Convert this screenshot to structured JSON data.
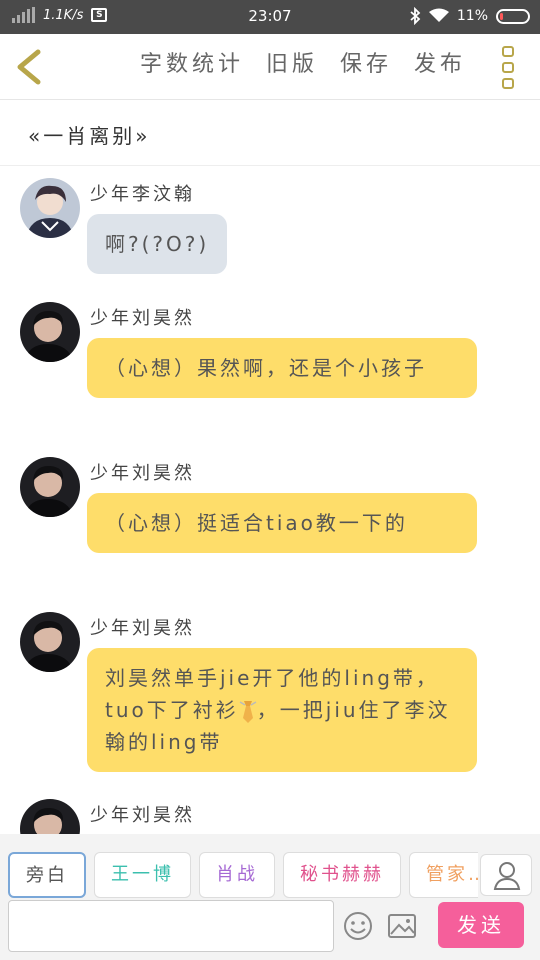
{
  "status_bar": {
    "speed": "1.1K/s",
    "screen_badge": "S",
    "time": "23:07",
    "battery_text": "11%",
    "battery_level": 0.11
  },
  "toolbar": {
    "actions": [
      "字数统计",
      "旧版",
      "保存",
      "发布"
    ],
    "accent": "#b8a64a"
  },
  "story": {
    "title": "«一肖离别»"
  },
  "messages": [
    {
      "name": "少年李汶翰",
      "text": "啊?(?O?)",
      "style": "gray",
      "avatar": "avatar-li-wenhan"
    },
    {
      "name": "少年刘昊然",
      "text": "（心想）果然啊，还是个小孩子",
      "style": "yellow",
      "avatar": "avatar-liu-haoran"
    },
    {
      "name": "少年刘昊然",
      "text": "（心想）挺适合tiao教一下的",
      "style": "yellow",
      "avatar": "avatar-liu-haoran"
    },
    {
      "name": "少年刘昊然",
      "text_before": "刘昊然单手jie开了他的ling带，tuo下了衬衫",
      "text_after": "，一把jiu住了李汶翰的ling带",
      "style": "yellow",
      "avatar": "avatar-liu-haoran"
    },
    {
      "name": "少年刘昊然",
      "style": "yellow",
      "avatar": "avatar-liu-haoran"
    }
  ],
  "roles": [
    {
      "label": "旁白",
      "color": "#555555",
      "active": true
    },
    {
      "label": "王一博",
      "color": "#3bbfae"
    },
    {
      "label": "肖战",
      "color": "#a66ad4"
    },
    {
      "label": "秘书赫赫",
      "color": "#e0528d"
    },
    {
      "label": "管家…",
      "color": "#f0a060"
    }
  ],
  "composer": {
    "placeholder": "",
    "send_label": "发送",
    "send_color": "#f55f9b"
  },
  "icons": [
    "back-chevron-icon",
    "more-icon",
    "person-icon",
    "emoji-icon",
    "image-icon",
    "tie-icon"
  ]
}
